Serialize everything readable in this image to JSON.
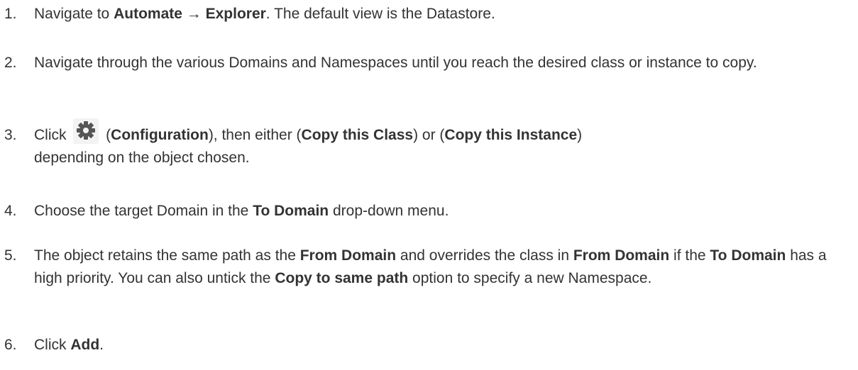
{
  "steps": [
    {
      "num": "1.",
      "parts": [
        "Navigate to ",
        "Automate",
        " → ",
        "Explorer",
        ". The default view is the Datastore."
      ]
    },
    {
      "num": "2.",
      "parts": [
        "Navigate through the various Domains and Namespaces until you reach the desired class or instance to copy."
      ]
    },
    {
      "num": "3.",
      "parts": [
        "Click ",
        " (",
        "Configuration",
        "), then either (",
        "Copy this Class",
        ") or (",
        "Copy this Instance",
        ")",
        "depending on the object chosen."
      ],
      "icon": "gear-icon"
    },
    {
      "num": "4.",
      "parts": [
        "Choose the target Domain in the ",
        "To Domain",
        " drop-down menu."
      ]
    },
    {
      "num": "5.",
      "parts": [
        "The object retains the same path as the ",
        "From Domain",
        " and overrides the class in ",
        "From Domain",
        " if the ",
        "To Domain",
        " has a high priority. You can also untick the ",
        "Copy to same path",
        " option to specify a new Namespace."
      ]
    },
    {
      "num": "6.",
      "parts": [
        "Click ",
        "Add",
        "."
      ]
    }
  ],
  "colors": {
    "text": "#333333",
    "icon": "#555555"
  }
}
